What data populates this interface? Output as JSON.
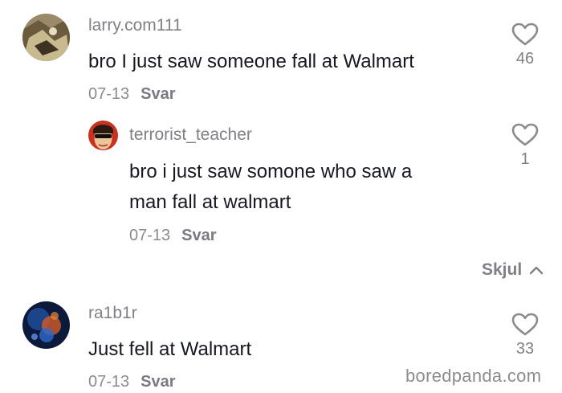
{
  "comments": [
    {
      "username": "larry.com111",
      "text": "bro I just saw someone fall at Walmart",
      "date": "07-13",
      "reply_label": "Svar",
      "likes": "46",
      "avatar_icon": "avatar-photo-icon"
    },
    {
      "username": "terrorist_teacher",
      "text_line1": "bro i just saw somone who saw a",
      "text_line2": "man fall at walmart",
      "date": "07-13",
      "reply_label": "Svar",
      "likes": "1",
      "avatar_icon": "avatar-photo-icon"
    },
    {
      "username": "ra1b1r",
      "text": "Just fell at Walmart",
      "date": "07-13",
      "reply_label": "Svar",
      "likes": "33",
      "avatar_icon": "avatar-photo-icon"
    }
  ],
  "hide_replies_label": "Skjul",
  "watermark": "boredpanda.com",
  "colors": {
    "text": "#161823",
    "secondary": "#7f8088",
    "background": "#ffffff"
  }
}
